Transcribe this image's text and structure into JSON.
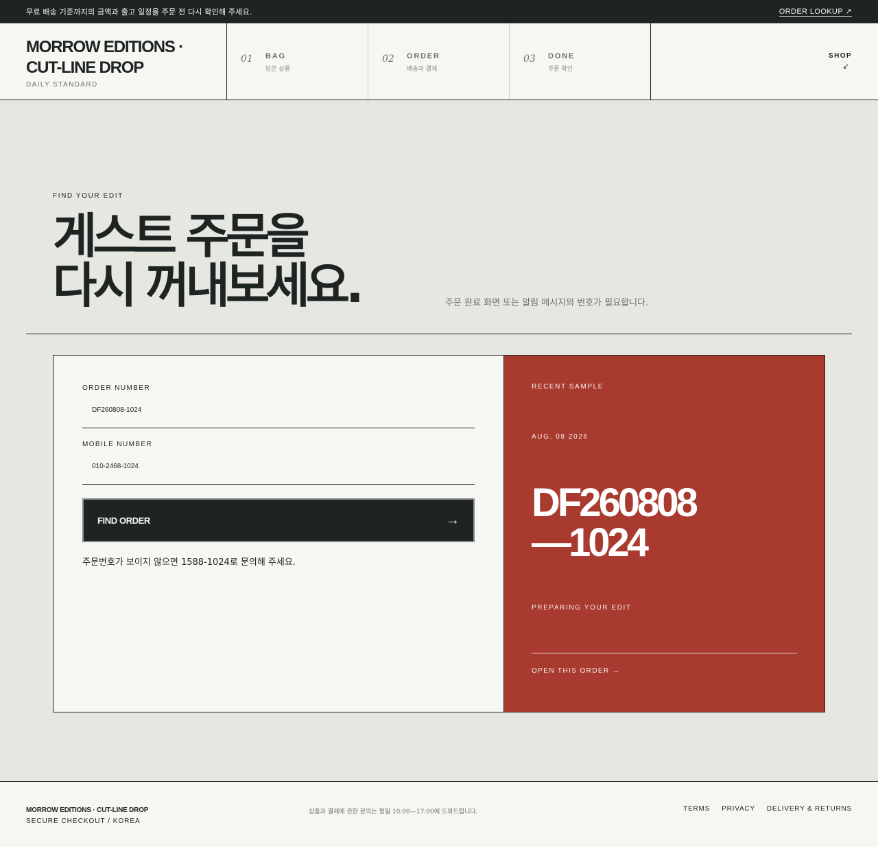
{
  "topbar": {
    "notice": "무료 배송 기준까지의 금액과 출고 일정을 주문 전 다시 확인해 주세요.",
    "lookup": "ORDER LOOKUP ↗"
  },
  "brand": {
    "name_line1": "MORROW EDITIONS ·",
    "name_line2": "CUT-LINE DROP",
    "sub": "DAILY STANDARD"
  },
  "steps": [
    {
      "num": "01",
      "label": "BAG",
      "ko": "담은 상품"
    },
    {
      "num": "02",
      "label": "ORDER",
      "ko": "배송과 결제"
    },
    {
      "num": "03",
      "label": "DONE",
      "ko": "주문 확인"
    }
  ],
  "shop": {
    "label": "SHOP",
    "arrow": "↙"
  },
  "hero": {
    "eyebrow": "FIND YOUR EDIT",
    "line1": "게스트 주문을",
    "line2": "다시 꺼내보세요.",
    "note": "주문 완료 화면 또는 알림 메시지의 번호가 필요합니다."
  },
  "form": {
    "order_label": "ORDER NUMBER",
    "order_value": "DF260808-1024",
    "mobile_label": "MOBILE NUMBER",
    "mobile_value": "010-2468-1024",
    "button": "FIND ORDER",
    "button_arrow": "→",
    "help": "주문번호가 보이지 않으면 1588-1024로 문의해 주세요."
  },
  "sample": {
    "title": "RECENT SAMPLE",
    "date": "AUG. 08 2026",
    "code_line1": "DF260808",
    "code_line2": "—1024",
    "status": "PREPARING YOUR EDIT",
    "open": "OPEN THIS ORDER →"
  },
  "footer": {
    "brand": "MORROW EDITIONS · CUT-LINE DROP",
    "sub": "SECURE CHECKOUT / KOREA",
    "mid": "상품과 결제에 관한 문의는 평일 10:00—17:00에 도와드립니다.",
    "links": [
      "TERMS",
      "PRIVACY",
      "DELIVERY & RETURNS"
    ]
  },
  "colors": {
    "ink": "#1e2422",
    "paper": "#f6f6f2",
    "background": "#e7e7e2",
    "accent": "#a93a2f"
  }
}
